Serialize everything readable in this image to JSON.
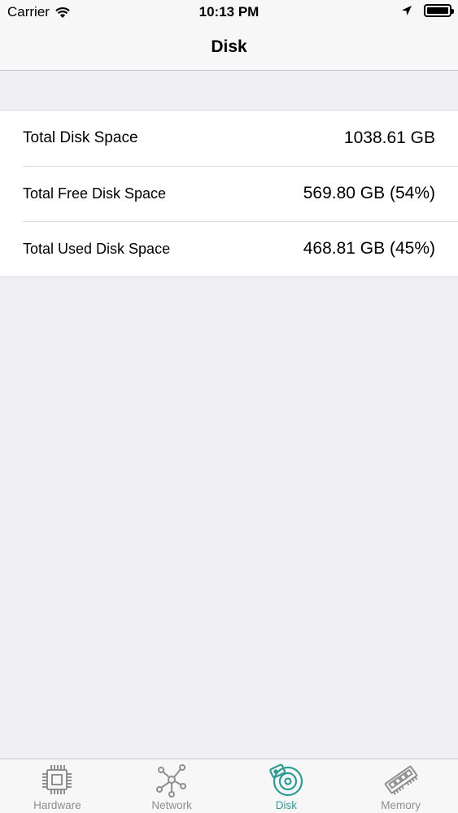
{
  "status_bar": {
    "carrier": "Carrier",
    "time": "10:13 PM"
  },
  "nav": {
    "title": "Disk"
  },
  "rows": [
    {
      "label": "Total Disk Space",
      "value": "1038.61 GB"
    },
    {
      "label": "Total Free Disk Space",
      "value": "569.80 GB (54%)"
    },
    {
      "label": "Total Used Disk Space",
      "value": "468.81 GB (45%)"
    }
  ],
  "tabs": [
    {
      "label": "Hardware",
      "icon": "chip-icon",
      "active": false
    },
    {
      "label": "Network",
      "icon": "network-icon",
      "active": false
    },
    {
      "label": "Disk",
      "icon": "disk-icon",
      "active": true
    },
    {
      "label": "Memory",
      "icon": "memory-icon",
      "active": false
    }
  ],
  "colors": {
    "accent": "#2a9d95",
    "inactive": "#8e8e93",
    "background": "#efeff4"
  }
}
